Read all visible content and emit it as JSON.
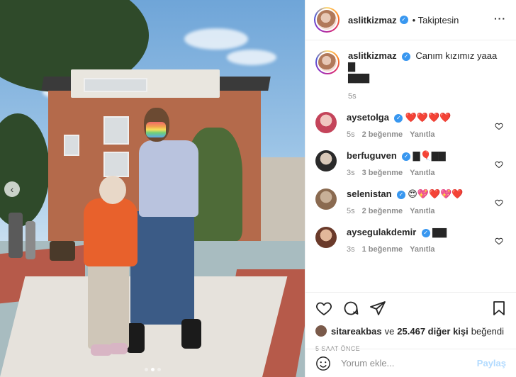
{
  "post": {
    "author": "aslitkizmaz",
    "follow_label": "• Takiptesin",
    "more_icon": "more-horizontal-icon",
    "caption": "Canım kızımız yaaa ▇\n▇▇▇",
    "caption_time": "5s"
  },
  "comments": [
    {
      "user": "aysetolga",
      "text": "❤️❤️❤️❤️",
      "time": "5s",
      "likes": "2 beğenme",
      "reply": "Yanıtla"
    },
    {
      "user": "berfuguven",
      "text": "▇🎈▇▇",
      "time": "3s",
      "likes": "3 beğenme",
      "reply": "Yanıtla"
    },
    {
      "user": "selenistan",
      "text": "😍💖❤️💖❤️",
      "time": "5s",
      "likes": "2 beğenme",
      "reply": "Yanıtla"
    },
    {
      "user": "aysegulakdemir",
      "text": "▇▇",
      "time": "3s",
      "likes": "1 beğenme",
      "reply": "Yanıtla"
    }
  ],
  "likes": {
    "first_user": "sitareakbas",
    "connector": "ve",
    "others": "25.467 diğer kişi",
    "suffix": "beğendi"
  },
  "time_ago": "5 SAAT ÖNCE",
  "comment_input": {
    "placeholder": "Yorum ekle...",
    "button": "Paylaş"
  },
  "colors": {
    "accent": "#3897f0",
    "post_button": "#b3dbff",
    "muted": "#8e8e8e"
  }
}
